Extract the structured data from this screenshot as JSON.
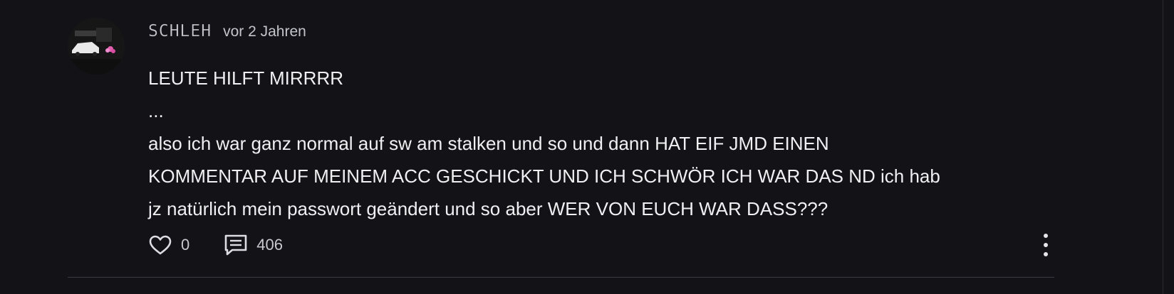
{
  "comment": {
    "author": "SCHLEH",
    "time": "vor 2 Jahren",
    "text": "LEUTE HILFT MIRRRR\n...\nalso ich war ganz normal auf sw am stalken und so und dann HAT EIF JMD EINEN\nKOMMENTAR AUF MEINEM ACC GESCHICKT UND ICH SCHWÖR ICH WAR DAS ND ich hab\njz natürlich mein passwort geändert und so aber WER VON EUCH WAR DASS???",
    "likes": "0",
    "replies": "406"
  },
  "icons": {
    "like": "heart-outline-icon",
    "reply": "comment-bubble-icon",
    "menu": "more-vertical-icon"
  },
  "colors": {
    "background": "#121217",
    "text": "#f0f0f2",
    "muted": "#c4c4cb",
    "divider": "#3a3a42"
  }
}
